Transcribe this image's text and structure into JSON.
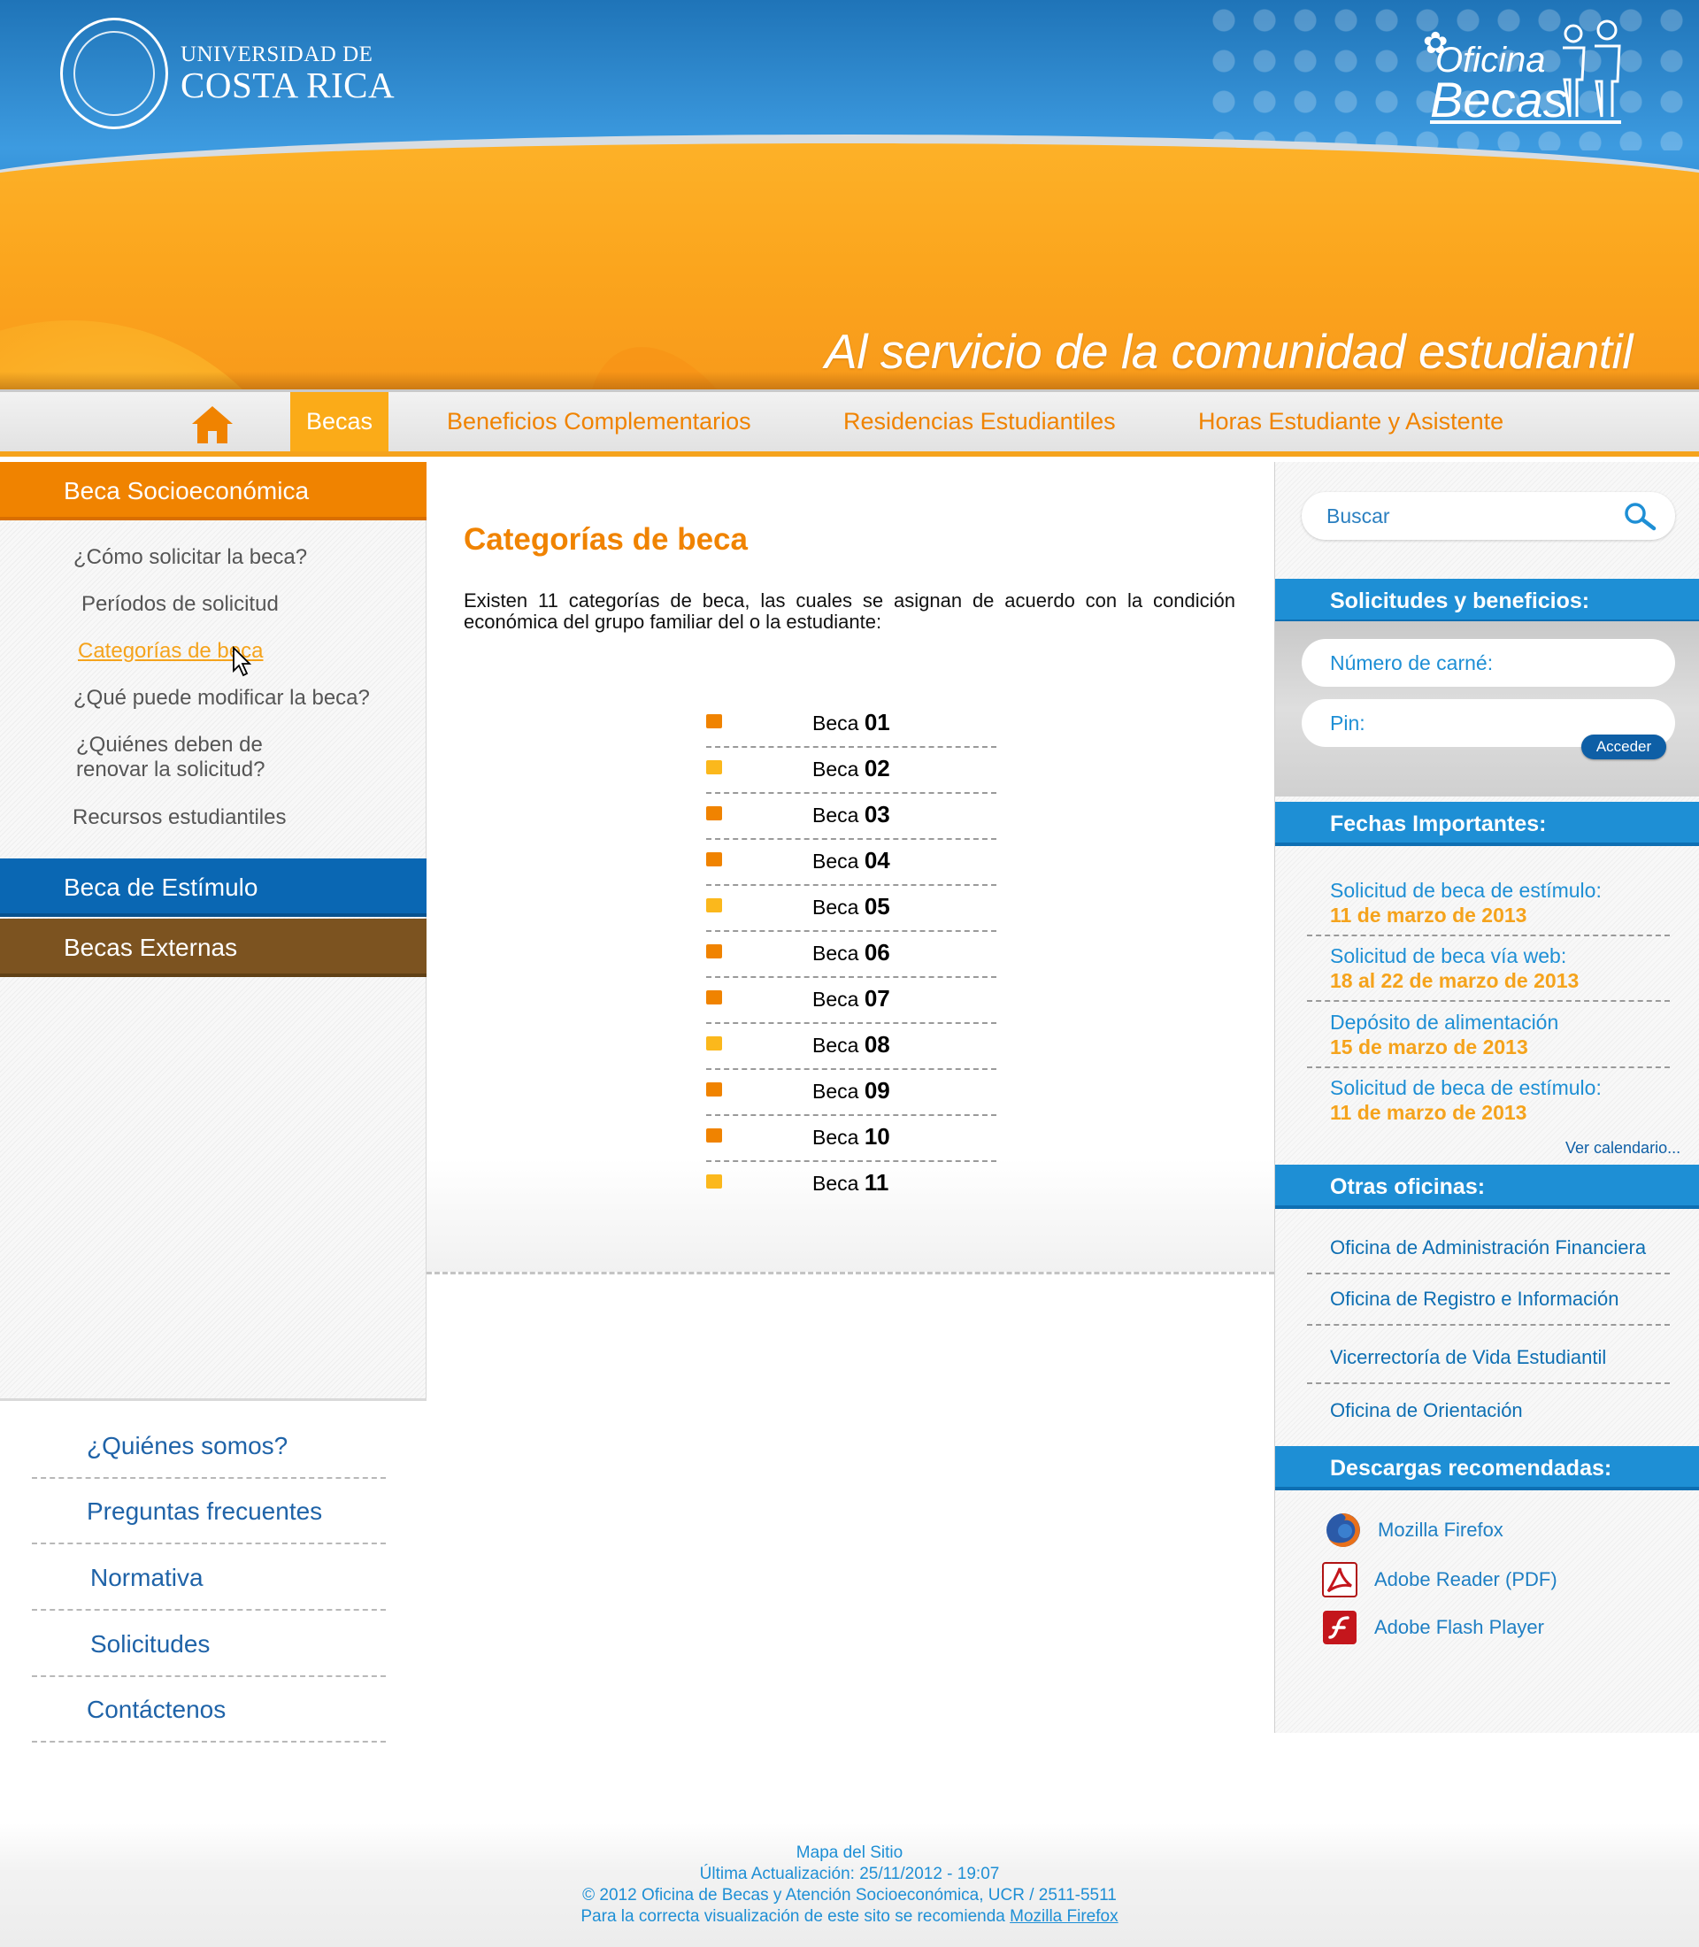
{
  "header": {
    "university_line1": "UNIVERSIDAD DE",
    "university_line2": "COSTA RICA",
    "office_word1": "Oficina",
    "office_word2": "Becas",
    "slogan": "Al servicio de la comunidad estudiantil"
  },
  "nav": {
    "home_icon": "home-icon",
    "items": [
      {
        "label": "Becas",
        "active": true
      },
      {
        "label": "Beneficios Complementarios"
      },
      {
        "label": "Residencias Estudiantiles"
      },
      {
        "label": "Horas Estudiante y Asistente"
      }
    ]
  },
  "sidebar": {
    "sections": [
      {
        "label": "Beca Socioeconómica",
        "color": "#f08300"
      },
      {
        "label": "Beca de Estímulo",
        "color": "#0a67b3"
      },
      {
        "label": "Becas Externas",
        "color": "#7c5320"
      }
    ],
    "subitems": [
      {
        "label": "¿Cómo solicitar la beca?"
      },
      {
        "label": "Períodos de solicitud"
      },
      {
        "label": "Categorías de beca",
        "active": true
      },
      {
        "label": "¿Qué puede modificar la beca?"
      },
      {
        "label_line1": "¿Quiénes deben de",
        "label_line2": "renovar la solicitud?"
      },
      {
        "label": "Recursos estudiantiles"
      }
    ],
    "bottom_links": [
      {
        "label": "¿Quiénes somos?"
      },
      {
        "label": "Preguntas frecuentes"
      },
      {
        "label": "Normativa"
      },
      {
        "label": "Solicitudes"
      },
      {
        "label": "Contáctenos"
      }
    ]
  },
  "main": {
    "title": "Categorías de beca",
    "intro": "Existen 11 categorías de beca, las cuales se asignan de acuerdo con la condición económica del grupo familiar del o la estudiante:",
    "beca_prefix": "Beca",
    "becas": [
      {
        "num": "01",
        "bullet_color": "#f08300"
      },
      {
        "num": "02",
        "bullet_color": "#fbb81c"
      },
      {
        "num": "03",
        "bullet_color": "#f08300"
      },
      {
        "num": "04",
        "bullet_color": "#f08300"
      },
      {
        "num": "05",
        "bullet_color": "#fbb81c"
      },
      {
        "num": "06",
        "bullet_color": "#f08300"
      },
      {
        "num": "07",
        "bullet_color": "#f08300"
      },
      {
        "num": "08",
        "bullet_color": "#fbb81c"
      },
      {
        "num": "09",
        "bullet_color": "#f08300"
      },
      {
        "num": "10",
        "bullet_color": "#f08300"
      },
      {
        "num": "11",
        "bullet_color": "#fbb81c"
      }
    ]
  },
  "right": {
    "search_placeholder": "Buscar",
    "solicitudes_heading": "Solicitudes y beneficios:",
    "carne_placeholder": "Número de carné:",
    "pin_placeholder": "Pin:",
    "acceder_label": "Acceder",
    "fechas_heading": "Fechas Importantes:",
    "fechas": [
      {
        "title": "Solicitud de beca de estímulo:",
        "date": "11 de marzo de 2013"
      },
      {
        "title": "Solicitud de beca vía web:",
        "date": "18 al 22 de marzo de 2013"
      },
      {
        "title": "Depósito de alimentación",
        "date": "15 de marzo de 2013"
      },
      {
        "title": "Solicitud de beca de estímulo:",
        "date": "11 de marzo de 2013"
      }
    ],
    "ver_calendario": "Ver calendario...",
    "oficinas_heading": "Otras oficinas:",
    "oficinas": [
      {
        "label": "Oficina de Administración Financiera"
      },
      {
        "label": "Oficina de Registro e Información"
      },
      {
        "label": "Vicerrectoría de Vida Estudiantil"
      },
      {
        "label": "Oficina de Orientación"
      }
    ],
    "descargas_heading": "Descargas recomendadas:",
    "descargas": [
      {
        "label": "Mozilla Firefox",
        "icon": "firefox-icon"
      },
      {
        "label": "Adobe Reader (PDF)",
        "icon": "adobe-reader-icon"
      },
      {
        "label": "Adobe Flash Player",
        "icon": "flash-player-icon"
      }
    ]
  },
  "footer": {
    "line1": "Mapa del Sitio",
    "line2": "Última Actualización: 25/11/2012 - 19:07",
    "line3": "© 2012 Oficina de Becas y Atención Socioeconómica, UCR  / 2511-5511",
    "line4_prefix": "Para la correcta visualización de este sito se recomienda",
    "line4_link": "Mozilla Firefox"
  },
  "colors": {
    "accent_orange": "#f08300",
    "accent_yellow": "#fbb81c",
    "accent_blue": "#1e8fd5",
    "brown": "#7c5320"
  }
}
